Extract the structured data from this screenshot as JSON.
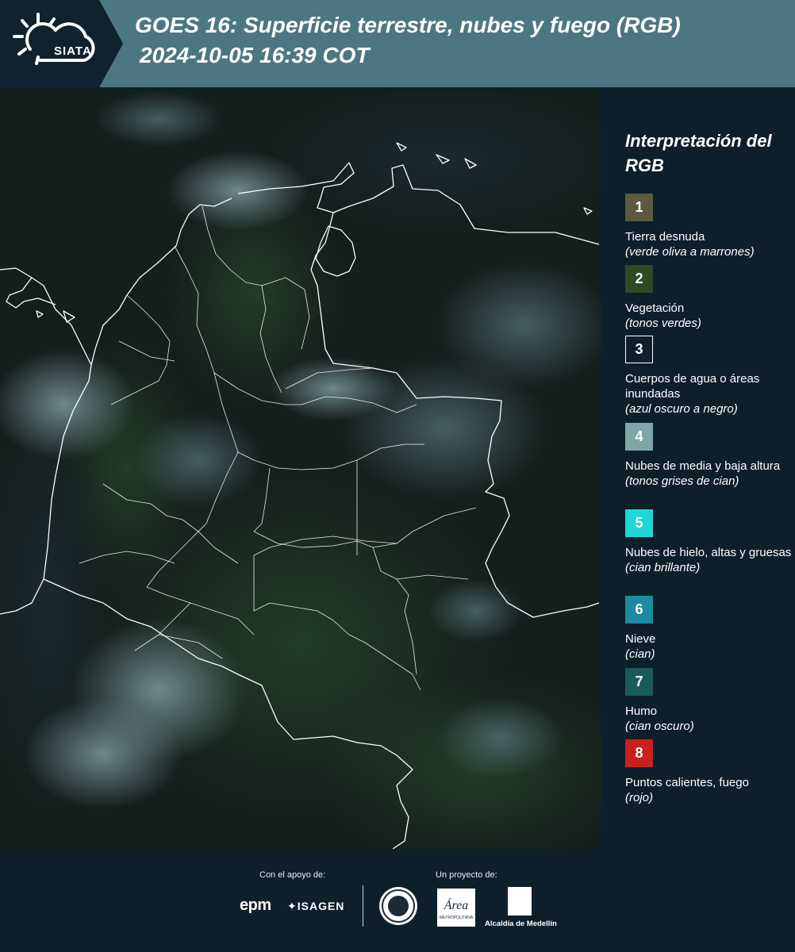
{
  "header": {
    "logo_text": "SIATA",
    "title_line1": "GOES 16: Superficie terrestre, nubes y fuego (RGB)",
    "title_line2": "2024-10-05 16:39 COT"
  },
  "map": {
    "icon": "satellite-composite-map"
  },
  "legend": {
    "title": "Interpretación del RGB",
    "items": [
      {
        "number": "1",
        "name": "Tierra desnuda",
        "desc": "(verde oliva a marrones)",
        "color": "#5b5a3e"
      },
      {
        "number": "2",
        "name": "Vegetación",
        "desc": "(tonos verdes)",
        "color": "#2e4a22"
      },
      {
        "number": "3",
        "name": "Cuerpos de agua o áreas inundadas",
        "desc": "(azul oscuro a negro)",
        "color": "#0d1f2b"
      },
      {
        "number": "4",
        "name": "Nubes de media y baja altura",
        "desc": "(tonos grises de cian)",
        "color": "#7fa6a6"
      },
      {
        "number": "5",
        "name": "Nubes de hielo, altas y gruesas",
        "desc": "(cian brillante)",
        "color": "#1fd6d6"
      },
      {
        "number": "6",
        "name": "Nieve",
        "desc": "(cian)",
        "color": "#1c8aa0"
      },
      {
        "number": "7",
        "name": "Humo",
        "desc": "(cian oscuro)",
        "color": "#1b5a5a"
      },
      {
        "number": "8",
        "name": "Puntos calientes, fuego",
        "desc": "(rojo)",
        "color": "#c8201f"
      }
    ]
  },
  "footer": {
    "support_label": "Con el apoyo de:",
    "project_label": "Un proyecto de:",
    "epm": "epm",
    "isagen": "ISAGEN",
    "area_text": "Área",
    "area_sub": "METROPOLITANA",
    "alcaldia": "Alcaldía de Medellín"
  }
}
